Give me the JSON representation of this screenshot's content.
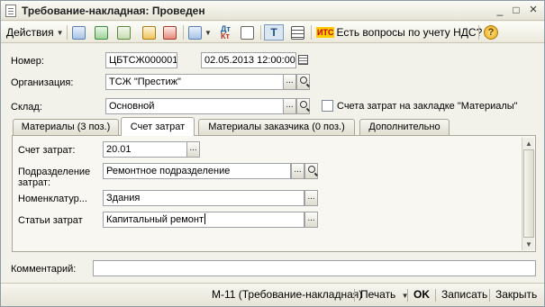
{
  "window": {
    "title": "Требование-накладная: Проведен",
    "controls": {
      "minimize": "_",
      "maximize": "□",
      "close": "×"
    }
  },
  "toolbar": {
    "actions_label": "Действия",
    "items": [
      "copy-icon",
      "refresh-icon",
      "new-icon",
      "post-icon",
      "unpost-icon",
      "structure-icon",
      "go-to-icon",
      "dt-kt-icon",
      "report-icon",
      "filter-icon",
      "list-icon"
    ],
    "its_badge": "ИТС",
    "vat_questions_label": "Есть вопросы по учету НДС?",
    "help_label": "?"
  },
  "form": {
    "number_label": "Номер:",
    "number_value": "ЦБТСЖ000001",
    "date_value": "02.05.2013 12:00:00",
    "organization_label": "Организация:",
    "organization_value": "ТСЖ \"Престиж\"",
    "warehouse_label": "Склад:",
    "warehouse_value": "Основной",
    "cost_account_checkbox_label": "Счета затрат на закладке \"Материалы\"",
    "cost_account_checkbox_checked": false,
    "select_btn": "...",
    "clear_btn": "..."
  },
  "tabs": [
    {
      "label": "Материалы (3 поз.)",
      "active": false
    },
    {
      "label": "Счет затрат",
      "active": true
    },
    {
      "label": "Материалы заказчика (0 поз.)",
      "active": false
    },
    {
      "label": "Дополнительно",
      "active": false
    }
  ],
  "cost_tab": {
    "account_label": "Счет затрат:",
    "account_value": "20.01",
    "department_label_line1": "Подразделение",
    "department_label_line2": "затрат:",
    "department_value": "Ремонтное подразделение",
    "nomenclature_label": "Номенклатур...",
    "nomenclature_value": "Здания",
    "cost_items_label": "Статьи затрат",
    "cost_items_value": "Капитальный ремонт"
  },
  "comment": {
    "label": "Комментарий:",
    "value": ""
  },
  "footer": {
    "print_form_label": "М-11 (Требование-накладная)",
    "print_label": "Печать",
    "ok_label": "OK",
    "save_label": "Записать",
    "close_label": "Закрыть"
  }
}
